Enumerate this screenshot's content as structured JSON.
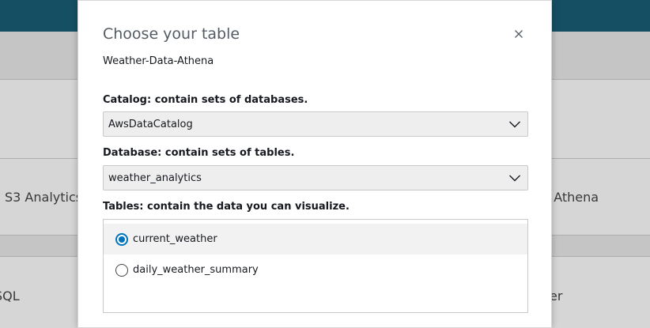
{
  "background": {
    "cards": [
      {
        "label": "S3 Analytics"
      },
      {
        "label": "SQL"
      },
      {
        "label": "n Athena"
      },
      {
        "label": "rver"
      }
    ]
  },
  "modal": {
    "title": "Choose your table",
    "subtitle": "Weather-Data-Athena",
    "close_icon": "close-icon",
    "catalog": {
      "label": "Catalog: contain sets of databases.",
      "value": "AwsDataCatalog"
    },
    "database": {
      "label": "Database: contain sets of tables.",
      "value": "weather_analytics"
    },
    "tables": {
      "label": "Tables: contain the data you can visualize.",
      "items": [
        {
          "name": "current_weather",
          "selected": true
        },
        {
          "name": "daily_weather_summary",
          "selected": false
        }
      ]
    }
  },
  "colors": {
    "header": "#1a5f78",
    "accent": "#0073bb"
  }
}
